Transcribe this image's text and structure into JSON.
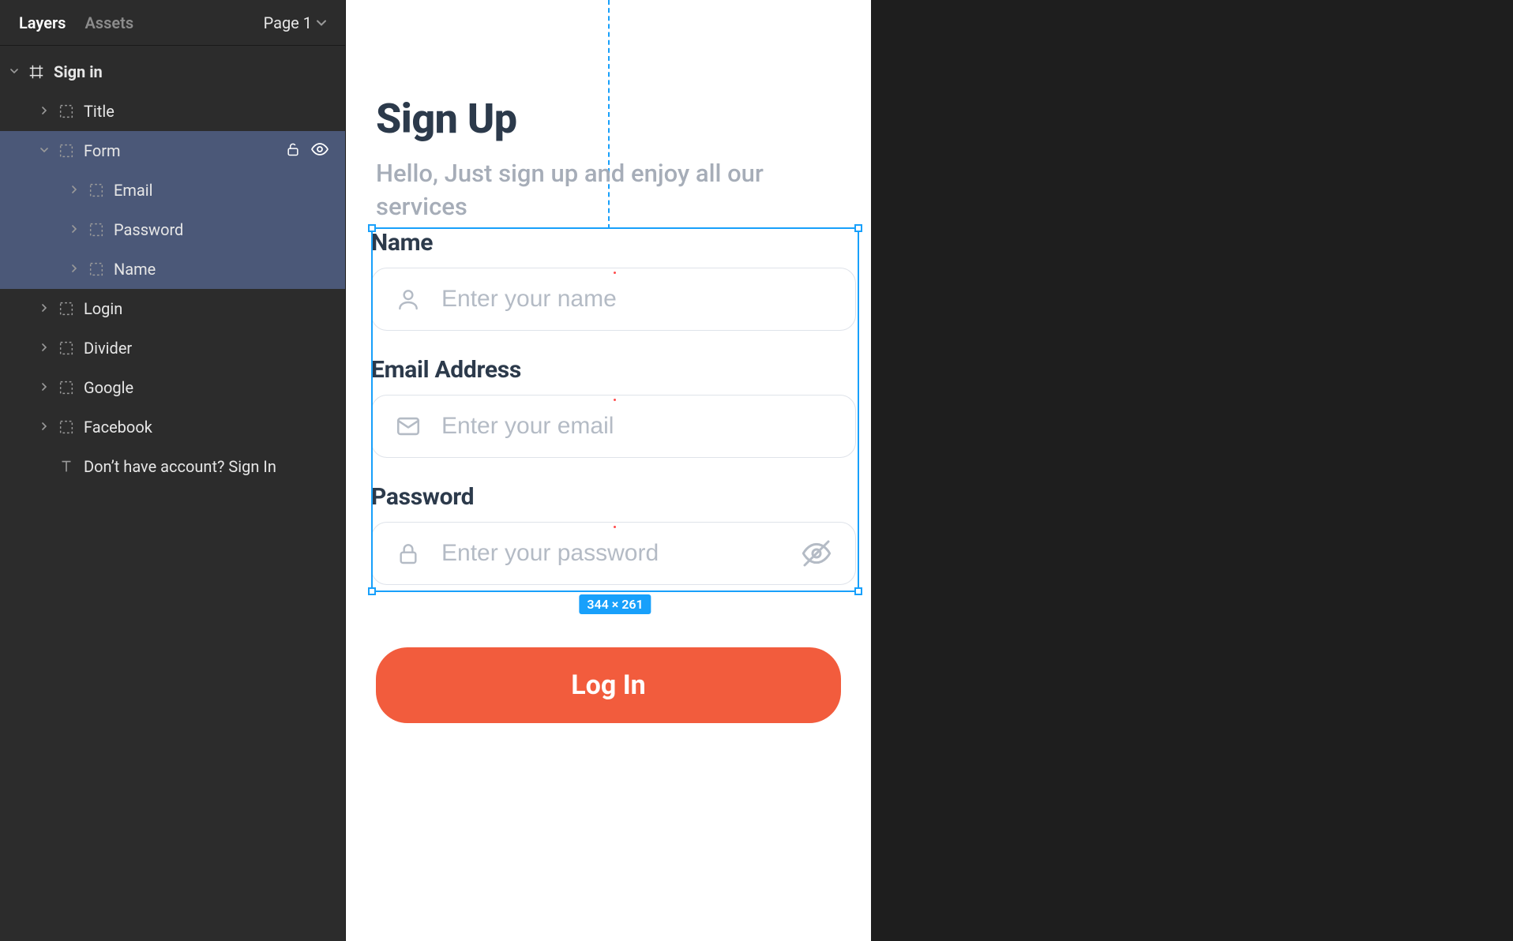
{
  "panel": {
    "tabs": {
      "layers": "Layers",
      "assets": "Assets"
    },
    "page_selector": "Page 1",
    "rows": [
      {
        "label": "Sign in",
        "depth": 0,
        "icon": "frame",
        "disclosure": "down",
        "bold": true,
        "selected": false
      },
      {
        "label": "Title",
        "depth": 1,
        "icon": "group",
        "disclosure": "right",
        "bold": false,
        "selected": false
      },
      {
        "label": "Form",
        "depth": 1,
        "icon": "group",
        "disclosure": "down",
        "bold": false,
        "selected": true,
        "actions": true
      },
      {
        "label": "Email",
        "depth": 2,
        "icon": "group",
        "disclosure": "right",
        "bold": false,
        "selected": true
      },
      {
        "label": "Password",
        "depth": 2,
        "icon": "group",
        "disclosure": "right",
        "bold": false,
        "selected": true
      },
      {
        "label": "Name",
        "depth": 2,
        "icon": "group",
        "disclosure": "right",
        "bold": false,
        "selected": true
      },
      {
        "label": "Login",
        "depth": 1,
        "icon": "group",
        "disclosure": "right",
        "bold": false,
        "selected": false
      },
      {
        "label": "Divider",
        "depth": 1,
        "icon": "group",
        "disclosure": "right",
        "bold": false,
        "selected": false
      },
      {
        "label": "Google",
        "depth": 1,
        "icon": "group",
        "disclosure": "right",
        "bold": false,
        "selected": false
      },
      {
        "label": "Facebook",
        "depth": 1,
        "icon": "group",
        "disclosure": "right",
        "bold": false,
        "selected": false
      },
      {
        "label": "Don’t have account? Sign In",
        "depth": 1,
        "icon": "text",
        "disclosure": "none",
        "bold": false,
        "selected": false
      }
    ]
  },
  "canvas": {
    "heading": "Sign Up",
    "subtitle": "Hello, Just sign up and enjoy all our services",
    "fields": {
      "name": {
        "label": "Name",
        "placeholder": "Enter your name"
      },
      "email": {
        "label": "Email Address",
        "placeholder": "Enter your email"
      },
      "password": {
        "label": "Password",
        "placeholder": "Enter your password"
      }
    },
    "login_button": "Log In",
    "selection_dims": "344 × 261"
  }
}
